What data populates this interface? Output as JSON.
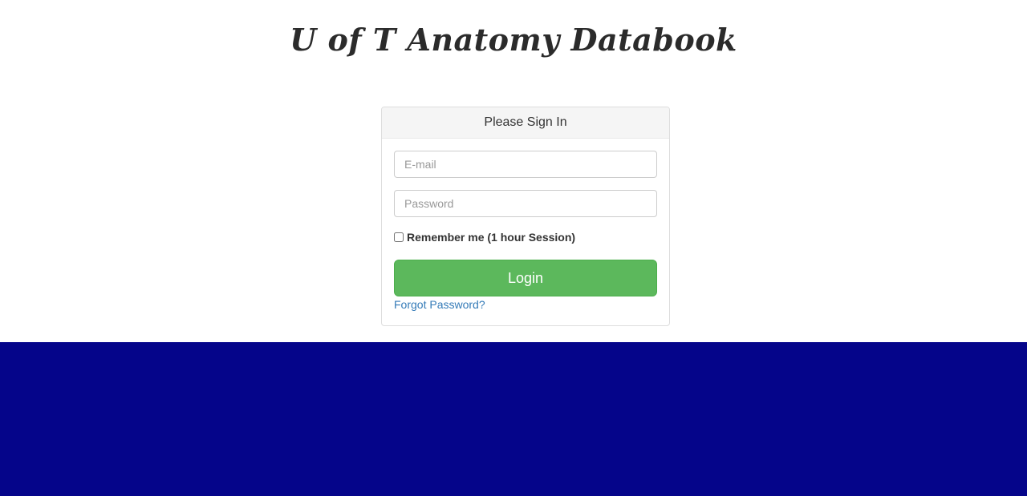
{
  "header": {
    "title": "U of T Anatomy Databook"
  },
  "signin_panel": {
    "heading": "Please Sign In",
    "email": {
      "placeholder": "E-mail",
      "value": ""
    },
    "password": {
      "placeholder": "Password",
      "value": ""
    },
    "remember_label": "Remember me (1 hour Session)",
    "remember_checked": false,
    "login_label": "Login",
    "forgot_label": "Forgot Password?"
  },
  "colors": {
    "login_button": "#5cb85c",
    "link": "#337ab7",
    "footer_band": "#05058a",
    "panel_heading_bg": "#f5f5f5"
  }
}
